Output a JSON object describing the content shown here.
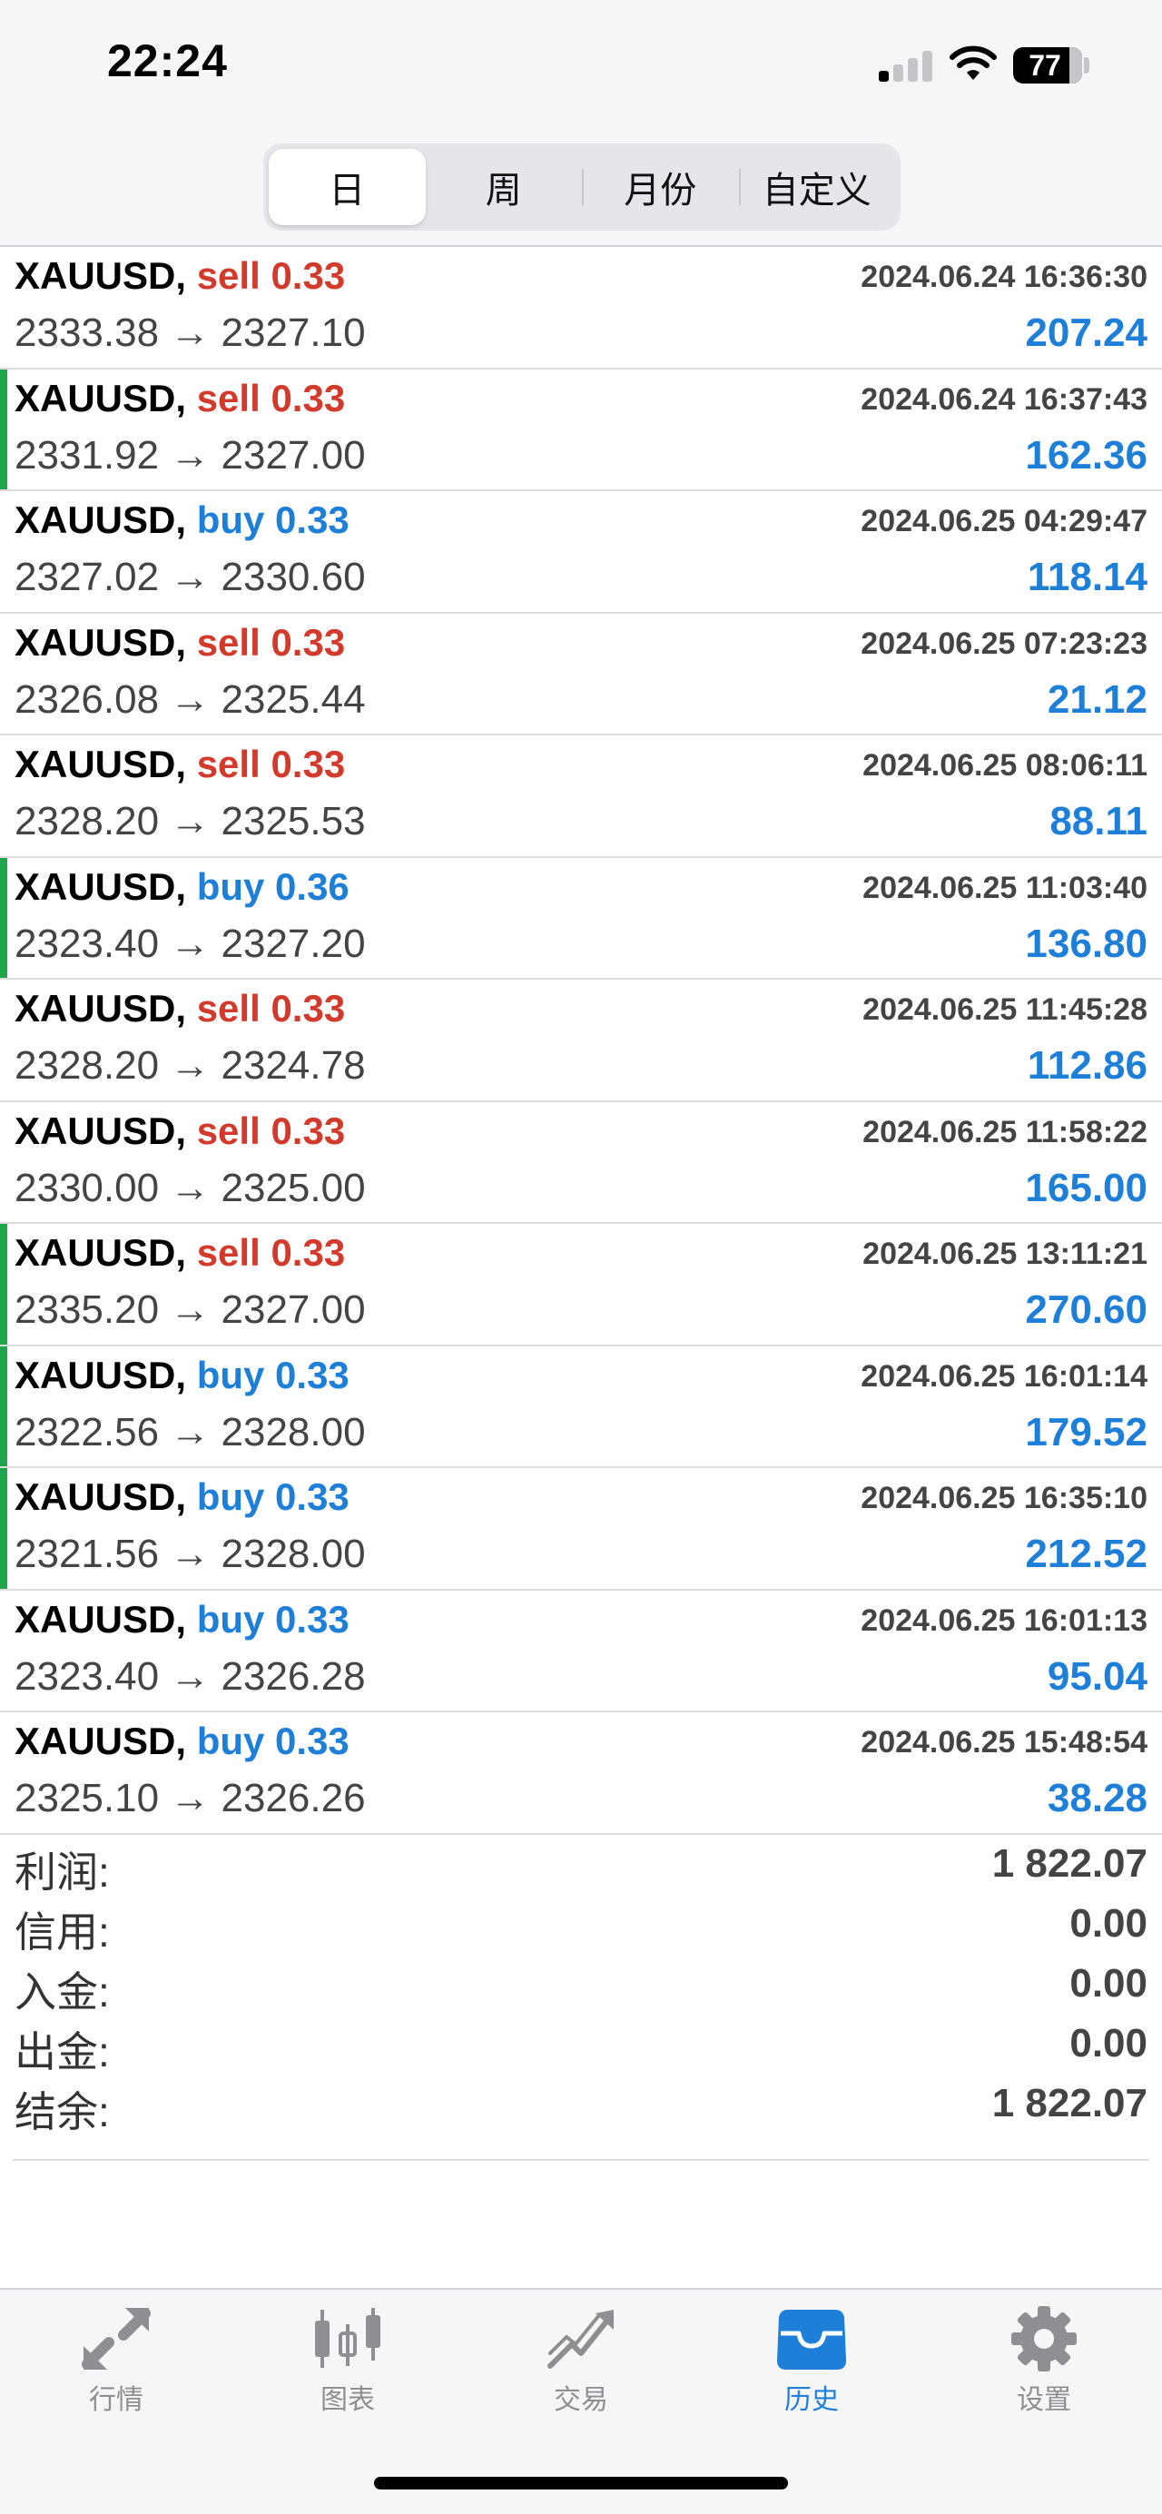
{
  "status_bar": {
    "time": "22:24",
    "battery": "77"
  },
  "period_tabs": [
    {
      "label": "日",
      "active": true
    },
    {
      "label": "周",
      "active": false
    },
    {
      "label": "月份",
      "active": false
    },
    {
      "label": "自定义",
      "active": false
    }
  ],
  "deals": [
    {
      "symbol": "XAUUSD,",
      "side": "sell",
      "volume": "0.33",
      "time": "2024.06.24 16:36:30",
      "prices": "2333.38 → 2327.10",
      "profit": "207.24",
      "marked": false
    },
    {
      "symbol": "XAUUSD,",
      "side": "sell",
      "volume": "0.33",
      "time": "2024.06.24 16:37:43",
      "prices": "2331.92 → 2327.00",
      "profit": "162.36",
      "marked": true
    },
    {
      "symbol": "XAUUSD,",
      "side": "buy",
      "volume": "0.33",
      "time": "2024.06.25 04:29:47",
      "prices": "2327.02 → 2330.60",
      "profit": "118.14",
      "marked": false
    },
    {
      "symbol": "XAUUSD,",
      "side": "sell",
      "volume": "0.33",
      "time": "2024.06.25 07:23:23",
      "prices": "2326.08 → 2325.44",
      "profit": "21.12",
      "marked": false
    },
    {
      "symbol": "XAUUSD,",
      "side": "sell",
      "volume": "0.33",
      "time": "2024.06.25 08:06:11",
      "prices": "2328.20 → 2325.53",
      "profit": "88.11",
      "marked": false
    },
    {
      "symbol": "XAUUSD,",
      "side": "buy",
      "volume": "0.36",
      "time": "2024.06.25 11:03:40",
      "prices": "2323.40 → 2327.20",
      "profit": "136.80",
      "marked": true
    },
    {
      "symbol": "XAUUSD,",
      "side": "sell",
      "volume": "0.33",
      "time": "2024.06.25 11:45:28",
      "prices": "2328.20 → 2324.78",
      "profit": "112.86",
      "marked": false
    },
    {
      "symbol": "XAUUSD,",
      "side": "sell",
      "volume": "0.33",
      "time": "2024.06.25 11:58:22",
      "prices": "2330.00 → 2325.00",
      "profit": "165.00",
      "marked": false
    },
    {
      "symbol": "XAUUSD,",
      "side": "sell",
      "volume": "0.33",
      "time": "2024.06.25 13:11:21",
      "prices": "2335.20 → 2327.00",
      "profit": "270.60",
      "marked": true
    },
    {
      "symbol": "XAUUSD,",
      "side": "buy",
      "volume": "0.33",
      "time": "2024.06.25 16:01:14",
      "prices": "2322.56 → 2328.00",
      "profit": "179.52",
      "marked": true
    },
    {
      "symbol": "XAUUSD,",
      "side": "buy",
      "volume": "0.33",
      "time": "2024.06.25 16:35:10",
      "prices": "2321.56 → 2328.00",
      "profit": "212.52",
      "marked": true
    },
    {
      "symbol": "XAUUSD,",
      "side": "buy",
      "volume": "0.33",
      "time": "2024.06.25 16:01:13",
      "prices": "2323.40 → 2326.28",
      "profit": "95.04",
      "marked": false
    },
    {
      "symbol": "XAUUSD,",
      "side": "buy",
      "volume": "0.33",
      "time": "2024.06.25 15:48:54",
      "prices": "2325.10 → 2326.26",
      "profit": "38.28",
      "marked": false
    }
  ],
  "summary": [
    {
      "key": "profit",
      "label": "利润:",
      "value": "1 822.07"
    },
    {
      "key": "credit",
      "label": "信用:",
      "value": "0.00"
    },
    {
      "key": "deposit",
      "label": "入金:",
      "value": "0.00"
    },
    {
      "key": "withdrawal",
      "label": "出金:",
      "value": "0.00"
    },
    {
      "key": "balance",
      "label": "结余:",
      "value": "1 822.07"
    }
  ],
  "tabbar": [
    {
      "key": "quotes",
      "label": "行情",
      "icon": "quotes-arrows-icon",
      "active": false
    },
    {
      "key": "charts",
      "label": "图表",
      "icon": "candlestick-icon",
      "active": false
    },
    {
      "key": "trade",
      "label": "交易",
      "icon": "trend-line-icon",
      "active": false
    },
    {
      "key": "history",
      "label": "历史",
      "icon": "inbox-tray-icon",
      "active": true
    },
    {
      "key": "settings",
      "label": "设置",
      "icon": "gear-icon",
      "active": false
    }
  ],
  "colors": {
    "sell": "#d23a2c",
    "buy": "#1e7fd9",
    "profit": "#1e7fd9",
    "marker": "#1fa64a",
    "tab_active": "#1e7fd9",
    "tab_inactive": "#8e8e93"
  }
}
